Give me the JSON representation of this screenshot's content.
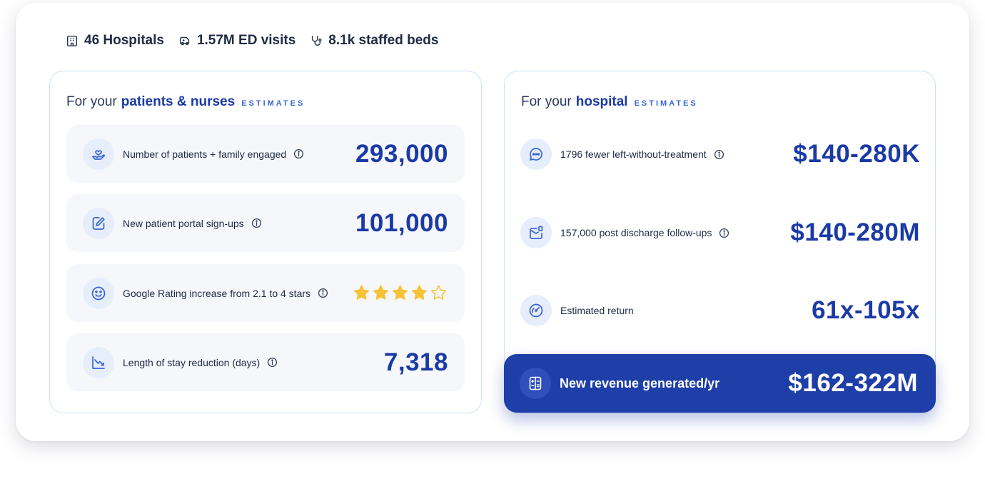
{
  "stats": [
    {
      "icon": "hospital-building-icon",
      "text": "46 Hospitals"
    },
    {
      "icon": "ambulance-icon",
      "text": "1.57M ED visits"
    },
    {
      "icon": "stethoscope-icon",
      "text": "8.1k staffed beds"
    }
  ],
  "patients_panel": {
    "prefix": "For your",
    "title": "patients & nurses",
    "tag": "ESTIMATES",
    "metrics": [
      {
        "icon": "hand-heart-icon",
        "label": "Number of patients + family engaged",
        "value": "293,000"
      },
      {
        "icon": "edit-document-icon",
        "label": "New patient portal sign-ups",
        "value": "101,000"
      },
      {
        "icon": "smiley-face-icon",
        "label": "Google Rating increase from 2.1 to 4 stars",
        "rating": 4,
        "rating_max": 5
      },
      {
        "icon": "trend-down-chart-icon",
        "label": "Length of stay reduction (days)",
        "value": "7,318"
      }
    ]
  },
  "hospital_panel": {
    "prefix": "For your",
    "title": "hospital",
    "tag": "ESTIMATES",
    "metrics": [
      {
        "icon": "chat-bubble-icon",
        "label": "1796 fewer left-without-treatment",
        "value": "$140-280K"
      },
      {
        "icon": "mail-notification-icon",
        "label": "157,000 post discharge follow-ups",
        "value": "$140-280M"
      },
      {
        "icon": "speedometer-icon",
        "label": "Estimated return",
        "value": "61x-105x"
      }
    ],
    "revenue": {
      "icon": "cash-register-icon",
      "label": "New revenue generated/yr",
      "value": "$162-322M"
    }
  },
  "colors": {
    "brand_blue": "#1b3aa6",
    "revenue_bg": "#1e3ea8",
    "star_gold": "#f6c338",
    "icon_bg": "#e6edfb",
    "row_bg": "#f5f7fb"
  }
}
